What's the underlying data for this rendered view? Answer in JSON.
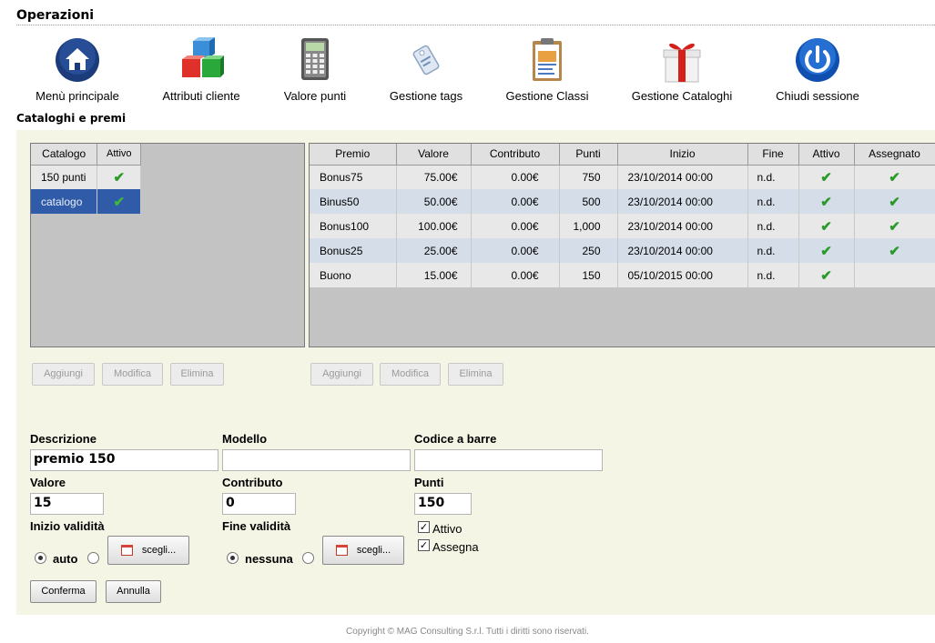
{
  "operations": {
    "title": "Operazioni",
    "items": [
      {
        "label": "Menù principale",
        "icon": "home-icon"
      },
      {
        "label": "Attributi cliente",
        "icon": "cubes-icon"
      },
      {
        "label": "Valore punti",
        "icon": "calculator-icon"
      },
      {
        "label": "Gestione tags",
        "icon": "tag-icon"
      },
      {
        "label": "Gestione Classi",
        "icon": "clipboard-icon"
      },
      {
        "label": "Gestione Cataloghi",
        "icon": "gift-icon"
      },
      {
        "label": "Chiudi sessione",
        "icon": "power-icon"
      }
    ]
  },
  "catalogs_section": {
    "title": "Cataloghi e premi"
  },
  "catalog_grid": {
    "headers": [
      "Catalogo",
      "Attivo"
    ],
    "rows": [
      {
        "name": "150 punti",
        "active": "✔",
        "selected": false
      },
      {
        "name": "catalogo",
        "active": "✔",
        "selected": true
      }
    ],
    "buttons": [
      "Aggiungi",
      "Modifica",
      "Elimina"
    ]
  },
  "prize_grid": {
    "headers": [
      "Premio",
      "Valore",
      "Contributo",
      "Punti",
      "Inizio",
      "Fine",
      "Attivo",
      "Assegnato"
    ],
    "rows": [
      {
        "premio": "Bonus75",
        "valore": "75.00€",
        "contributo": "0.00€",
        "punti": "750",
        "inizio": "23/10/2014 00:00",
        "fine": "n.d.",
        "attivo": "✔",
        "assegnato": "✔"
      },
      {
        "premio": "Binus50",
        "valore": "50.00€",
        "contributo": "0.00€",
        "punti": "500",
        "inizio": "23/10/2014 00:00",
        "fine": "n.d.",
        "attivo": "✔",
        "assegnato": "✔"
      },
      {
        "premio": "Bonus100",
        "valore": "100.00€",
        "contributo": "0.00€",
        "punti": "1,000",
        "inizio": "23/10/2014 00:00",
        "fine": "n.d.",
        "attivo": "✔",
        "assegnato": "✔"
      },
      {
        "premio": "Bonus25",
        "valore": "25.00€",
        "contributo": "0.00€",
        "punti": "250",
        "inizio": "23/10/2014 00:00",
        "fine": "n.d.",
        "attivo": "✔",
        "assegnato": "✔"
      },
      {
        "premio": "Buono",
        "valore": "15.00€",
        "contributo": "0.00€",
        "punti": "150",
        "inizio": "05/10/2015 00:00",
        "fine": "n.d.",
        "attivo": "✔",
        "assegnato": ""
      }
    ],
    "buttons": [
      "Aggiungi",
      "Modifica",
      "Elimina"
    ]
  },
  "form": {
    "descrizione": {
      "label": "Descrizione",
      "value": "premio 150"
    },
    "modello": {
      "label": "Modello",
      "value": ""
    },
    "codice": {
      "label": "Codice a barre",
      "value": ""
    },
    "valore": {
      "label": "Valore",
      "value": "15"
    },
    "contributo": {
      "label": "Contributo",
      "value": "0"
    },
    "punti": {
      "label": "Punti",
      "value": "150"
    },
    "inizio": {
      "label": "Inizio validità",
      "auto_label": "auto",
      "choose_label": "scegli..."
    },
    "fine": {
      "label": "Fine validità",
      "none_label": "nessuna",
      "choose_label": "scegli..."
    },
    "attivo": {
      "label": "Attivo",
      "checked": true
    },
    "assegna": {
      "label": "Assegna",
      "checked": true
    },
    "confirm_label": "Conferma",
    "cancel_label": "Annulla"
  },
  "footer": "Copyright © MAG Consulting S.r.l. Tutti i diritti sono riservati."
}
